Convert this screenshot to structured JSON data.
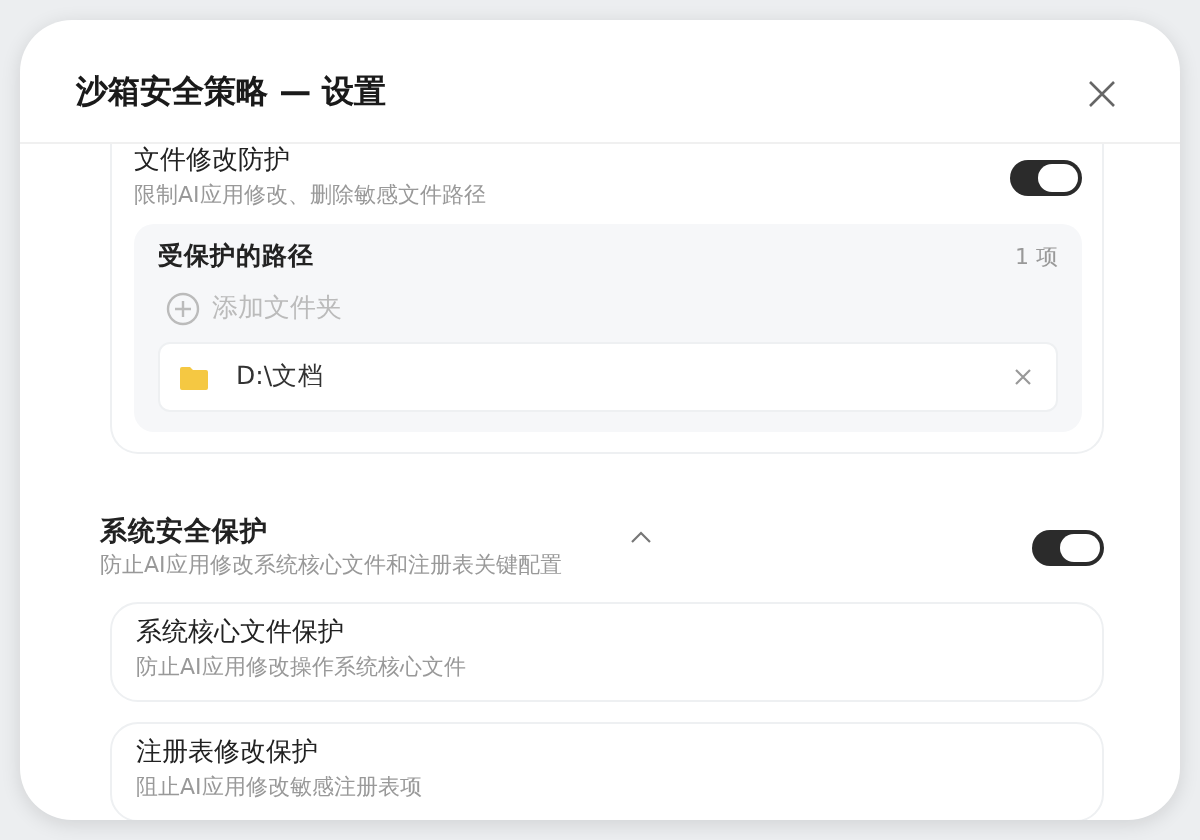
{
  "dialog": {
    "title": "沙箱安全策略 — 设置"
  },
  "file_protection": {
    "title": "文件修改防护",
    "description": "限制AI应用修改、删除敏感文件路径",
    "on": true,
    "protected_paths": {
      "title": "受保护的路径",
      "count": "1 项",
      "add_label": "添加文件夹",
      "add_disabled": true,
      "paths": [
        {
          "path": "D:\\文档"
        }
      ]
    }
  },
  "system_protection": {
    "title": "系统安全保护",
    "description": "防止AI应用修改系统核心文件和注册表关键配置",
    "expanded": true,
    "on": true,
    "items": [
      {
        "title": "系统核心文件保护",
        "description": "防止AI应用修改操作系统核心文件"
      },
      {
        "title": "注册表修改保护",
        "description": "阻止AI应用修改敏感注册表项"
      }
    ]
  }
}
